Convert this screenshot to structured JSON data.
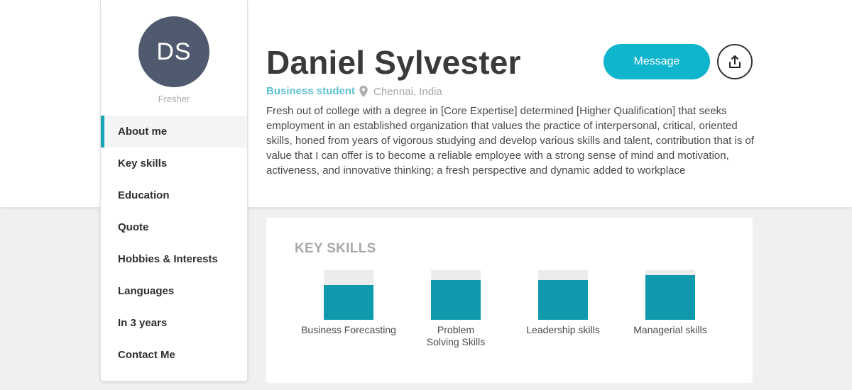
{
  "profile": {
    "initials": "DS",
    "status": "Fresher",
    "name": "Daniel Sylvester",
    "role": "Business student",
    "location": "Chennai, India",
    "bio": "Fresh out of college with a degree in [Core Expertise] determined [Higher Qualification] that seeks employment in an established organization that values the practice of interpersonal, critical, oriented skills, honed from years of vigorous studying and develop various skills and talent, contribution that is of value that I can offer is to become a reliable employee with a strong sense of mind and motivation, activeness, and innovative thinking; a fresh perspective and dynamic added to workplace"
  },
  "nav": {
    "items": [
      {
        "label": "About me",
        "active": true
      },
      {
        "label": "Key skills"
      },
      {
        "label": "Education"
      },
      {
        "label": "Quote"
      },
      {
        "label": "Hobbies & Interests"
      },
      {
        "label": "Languages"
      },
      {
        "label": "In 3 years"
      },
      {
        "label": "Contact Me"
      }
    ]
  },
  "actions": {
    "message_label": "Message",
    "share_icon": "share-icon"
  },
  "skills": {
    "title": "KEY SKILLS",
    "items": [
      {
        "label": "Business Forecasting",
        "level": 0.7
      },
      {
        "label": "Problem Solving Skills",
        "level": 0.8
      },
      {
        "label": "Leadership skills",
        "level": 0.8
      },
      {
        "label": "Managerial skills",
        "level": 0.9
      }
    ]
  },
  "colors": {
    "accent": "#0fb4cd",
    "bar": "#0e99ad",
    "avatar": "#505a6e",
    "role": "#5ec0d4"
  }
}
